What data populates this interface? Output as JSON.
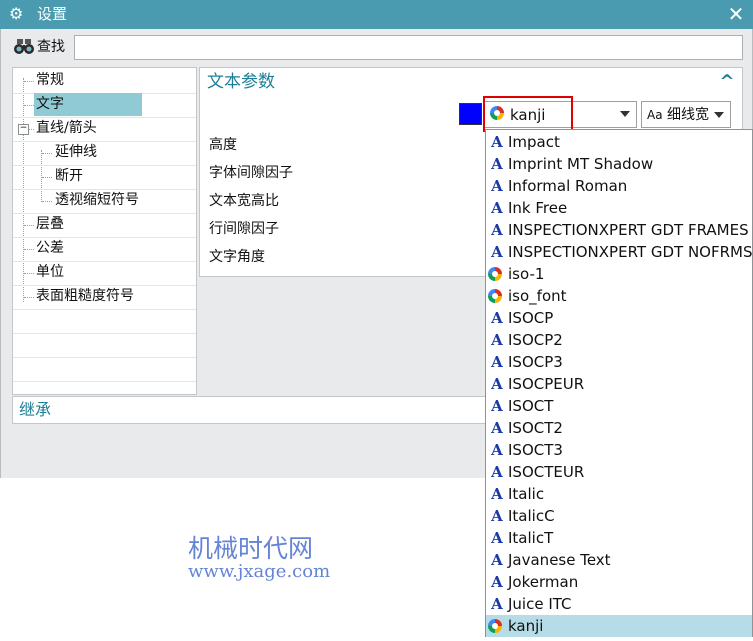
{
  "window": {
    "title": "设置",
    "gear_icon": "gear-icon",
    "close_glyph": "✕"
  },
  "search": {
    "label": "查找",
    "value": "",
    "icon": "binoculars-icon"
  },
  "tree": {
    "items": [
      {
        "label": "常规",
        "level": 1
      },
      {
        "label": "文字",
        "level": 1,
        "selected": true
      },
      {
        "label": "直线/箭头",
        "level": 1,
        "expanded": true
      },
      {
        "label": "延伸线",
        "level": 2
      },
      {
        "label": "断开",
        "level": 2
      },
      {
        "label": "透视缩短符号",
        "level": 2
      },
      {
        "label": "层叠",
        "level": 1
      },
      {
        "label": "公差",
        "level": 1
      },
      {
        "label": "单位",
        "level": 1
      },
      {
        "label": "表面粗糙度符号",
        "level": 1
      }
    ],
    "expander_glyph": "−"
  },
  "section": {
    "title": "文本参数",
    "collapse_glyph": "^"
  },
  "color": {
    "swatch": "#0000ff"
  },
  "font_select": {
    "value": "kanji",
    "icon": "nx-font-icon"
  },
  "style_select": {
    "aa": "Aa",
    "value": "细线宽"
  },
  "params": [
    "高度",
    "字体间隙因子",
    "文本宽高比",
    "行间隙因子",
    "文字角度"
  ],
  "inherit": {
    "label": "继承"
  },
  "watermark": {
    "line1": "机械时代网",
    "line2": "www.jxage.com"
  },
  "dropdown": {
    "items": [
      {
        "label": "Impact",
        "icon": "truetype"
      },
      {
        "label": "Imprint MT Shadow",
        "icon": "truetype"
      },
      {
        "label": "Informal Roman",
        "icon": "truetype"
      },
      {
        "label": "Ink Free",
        "icon": "truetype"
      },
      {
        "label": "INSPECTIONXPERT GDT FRAMES",
        "icon": "truetype"
      },
      {
        "label": "INSPECTIONXPERT GDT NOFRMS",
        "icon": "truetype"
      },
      {
        "label": "iso-1",
        "icon": "nx"
      },
      {
        "label": "iso_font",
        "icon": "nx"
      },
      {
        "label": "ISOCP",
        "icon": "truetype"
      },
      {
        "label": "ISOCP2",
        "icon": "truetype"
      },
      {
        "label": "ISOCP3",
        "icon": "truetype"
      },
      {
        "label": "ISOCPEUR",
        "icon": "truetype"
      },
      {
        "label": "ISOCT",
        "icon": "truetype"
      },
      {
        "label": "ISOCT2",
        "icon": "truetype"
      },
      {
        "label": "ISOCT3",
        "icon": "truetype"
      },
      {
        "label": "ISOCTEUR",
        "icon": "truetype"
      },
      {
        "label": "Italic",
        "icon": "truetype"
      },
      {
        "label": "ItalicC",
        "icon": "truetype"
      },
      {
        "label": "ItalicT",
        "icon": "truetype"
      },
      {
        "label": "Javanese Text",
        "icon": "truetype"
      },
      {
        "label": "Jokerman",
        "icon": "truetype"
      },
      {
        "label": "Juice ITC",
        "icon": "truetype"
      },
      {
        "label": "kanji",
        "icon": "nx",
        "selected": true
      }
    ],
    "tt_glyph": "A"
  }
}
